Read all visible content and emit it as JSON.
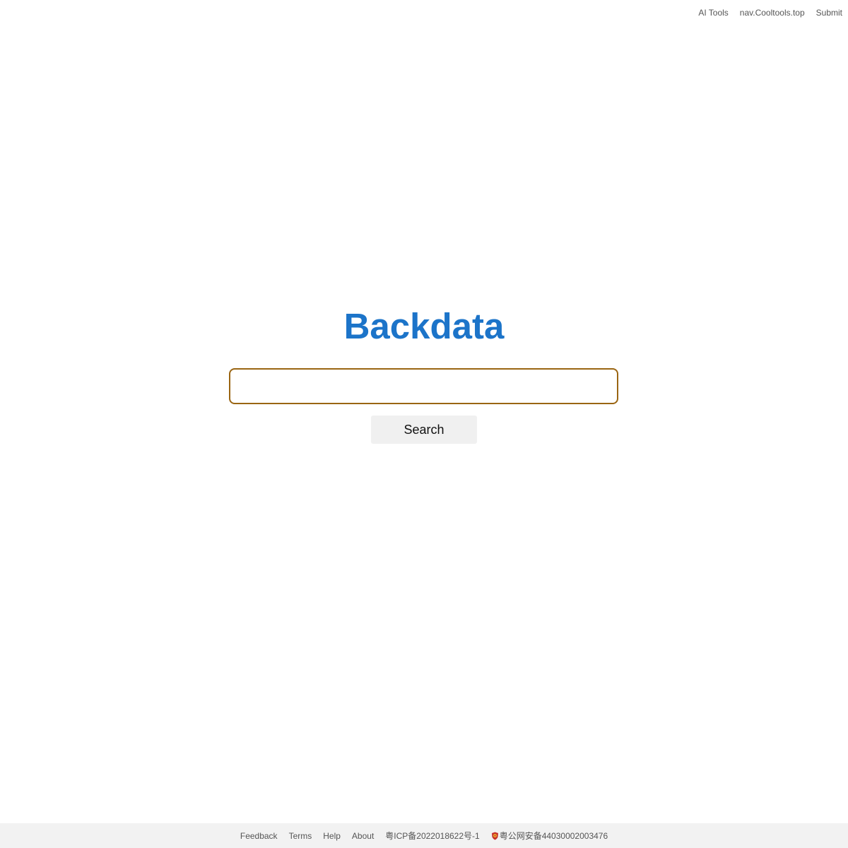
{
  "top_nav": {
    "items": [
      {
        "label": "AI Tools"
      },
      {
        "label": "nav.Cooltools.top"
      },
      {
        "label": "Submit"
      }
    ]
  },
  "logo": {
    "text": "Backdata",
    "color": "#1c74c9"
  },
  "search": {
    "value": "",
    "placeholder": "",
    "border_color": "#9a6512",
    "button_label": "Search"
  },
  "footer": {
    "links": [
      {
        "label": "Feedback"
      },
      {
        "label": "Terms"
      },
      {
        "label": "Help"
      },
      {
        "label": "About"
      }
    ],
    "icp": "粤ICP备2022018622号-1",
    "police": {
      "icon": "police-badge-icon",
      "label": "粤公网安备44030002003476"
    }
  }
}
